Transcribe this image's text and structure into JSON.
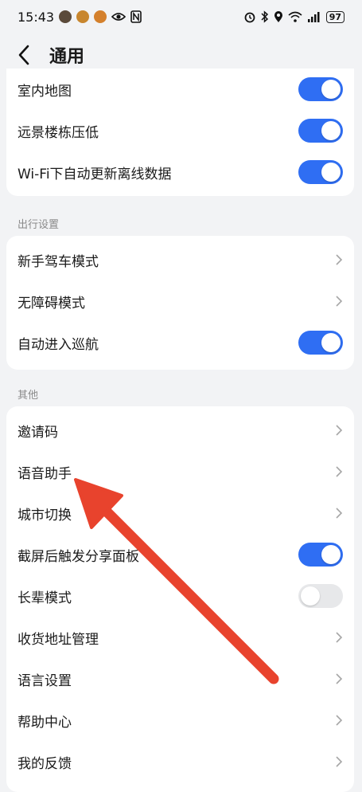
{
  "status_bar": {
    "time": "15:43",
    "battery": "97",
    "left_icons": [
      "app-icon",
      "app-icon",
      "app-icon",
      "eye-icon",
      "nfc-icon"
    ],
    "right_icons": [
      "alarm-icon",
      "bluetooth-icon",
      "location-icon",
      "wifi-icon",
      "signal-icon",
      "battery-icon"
    ]
  },
  "header": {
    "title": "通用"
  },
  "map_section": {
    "items": [
      {
        "label": "室内地图",
        "control": "toggle",
        "on": true
      },
      {
        "label": "远景楼栋压低",
        "control": "toggle",
        "on": true
      },
      {
        "label": "Wi-Fi下自动更新离线数据",
        "control": "toggle",
        "on": true
      }
    ]
  },
  "travel_section": {
    "title": "出行设置",
    "items": [
      {
        "label": "新手驾车模式",
        "control": "chevron"
      },
      {
        "label": "无障碍模式",
        "control": "chevron"
      },
      {
        "label": "自动进入巡航",
        "control": "toggle",
        "on": true
      }
    ]
  },
  "other_section": {
    "title": "其他",
    "items": [
      {
        "label": "邀请码",
        "control": "chevron"
      },
      {
        "label": "语音助手",
        "control": "chevron"
      },
      {
        "label": "城市切换",
        "control": "chevron"
      },
      {
        "label": "截屏后触发分享面板",
        "control": "toggle",
        "on": true
      },
      {
        "label": "长辈模式",
        "control": "toggle",
        "on": false
      },
      {
        "label": "收货地址管理",
        "control": "chevron"
      },
      {
        "label": "语言设置",
        "control": "chevron"
      },
      {
        "label": "帮助中心",
        "control": "chevron"
      },
      {
        "label": "我的反馈",
        "control": "chevron"
      }
    ]
  },
  "colors": {
    "accent": "#2f6ef3",
    "annotation_arrow": "#e8432d",
    "background": "#f2f3f5"
  }
}
